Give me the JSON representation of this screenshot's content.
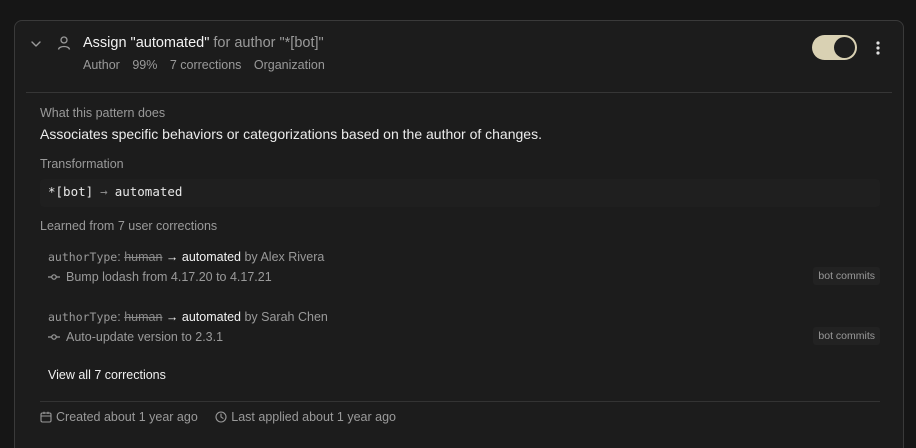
{
  "pattern": {
    "title_main": "Assign \"automated\"",
    "title_suffix": "for author \"*[bot]\"",
    "meta": [
      "Author",
      "99%",
      "7 corrections",
      "Organization"
    ],
    "enabled": true
  },
  "details": {
    "what_label": "What this pattern does",
    "description": "Associates specific behaviors or categorizations based on the author of changes.",
    "transformation_label": "Transformation",
    "transformation_from": "*[bot]",
    "transformation_to": "automated",
    "learned_label": "Learned from 7 user corrections",
    "corrections": [
      {
        "field": "authorType",
        "old": "human",
        "new": "automated",
        "by": "by Alex Rivera",
        "commit": "Bump lodash from 4.17.20 to 4.17.21",
        "tag": "bot commits"
      },
      {
        "field": "authorType",
        "old": "human",
        "new": "automated",
        "by": "by Sarah Chen",
        "commit": "Auto-update version to 2.3.1",
        "tag": "bot commits"
      }
    ],
    "view_all": "View all 7 corrections"
  },
  "footer": {
    "created": "Created about 1 year ago",
    "last_applied": "Last applied about 1 year ago"
  },
  "colors": {
    "toggle_on": "#d9d1b3",
    "background": "#1c1c1c",
    "border": "#3a3a3a"
  }
}
